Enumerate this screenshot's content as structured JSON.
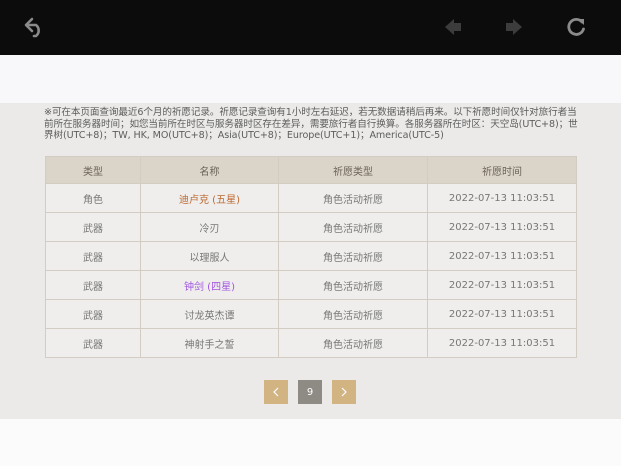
{
  "toolbar": {
    "back_icon": "back-arrow-icon",
    "prev_icon": "nav-left-icon",
    "next_icon": "nav-right-icon",
    "refresh_icon": "refresh-icon"
  },
  "notice": {
    "text": "※可在本页面查询最近6个月的祈愿记录。祈愿记录查询有1小时左右延迟，若无数据请稍后再来。以下祈愿时间仅针对旅行者当前所在服务器时间；如您当前所在时区与服务器时区存在差异，需要旅行者自行换算。各服务器所在时区：天空岛(UTC+8)；世界树(UTC+8)；TW, HK, MO(UTC+8)；Asia(UTC+8)；Europe(UTC+1)；America(UTC-5)"
  },
  "table": {
    "headers": [
      "类型",
      "名称",
      "祈愿类型",
      "祈愿时间"
    ],
    "rows": [
      {
        "type": "角色",
        "name": "迪卢克 (五星)",
        "wish_type": "角色活动祈愿",
        "time": "2022-07-13 11:03:51",
        "rarity": "5"
      },
      {
        "type": "武器",
        "name": "冷刃",
        "wish_type": "角色活动祈愿",
        "time": "2022-07-13 11:03:51",
        "rarity": "3"
      },
      {
        "type": "武器",
        "name": "以理服人",
        "wish_type": "角色活动祈愿",
        "time": "2022-07-13 11:03:51",
        "rarity": "3"
      },
      {
        "type": "武器",
        "name": "钟剑 (四星)",
        "wish_type": "角色活动祈愿",
        "time": "2022-07-13 11:03:51",
        "rarity": "4"
      },
      {
        "type": "武器",
        "name": "讨龙英杰谭",
        "wish_type": "角色活动祈愿",
        "time": "2022-07-13 11:03:51",
        "rarity": "3"
      },
      {
        "type": "武器",
        "name": "神射手之誓",
        "wish_type": "角色活动祈愿",
        "time": "2022-07-13 11:03:51",
        "rarity": "3"
      }
    ]
  },
  "pagination": {
    "current_page": "9",
    "prev_icon": "chevron-left-icon",
    "next_icon": "chevron-right-icon"
  },
  "colors": {
    "five_star": "#bd6932",
    "four_star": "#a256e1",
    "pager_button": "#d2b483",
    "pager_current": "#8e8b85"
  }
}
